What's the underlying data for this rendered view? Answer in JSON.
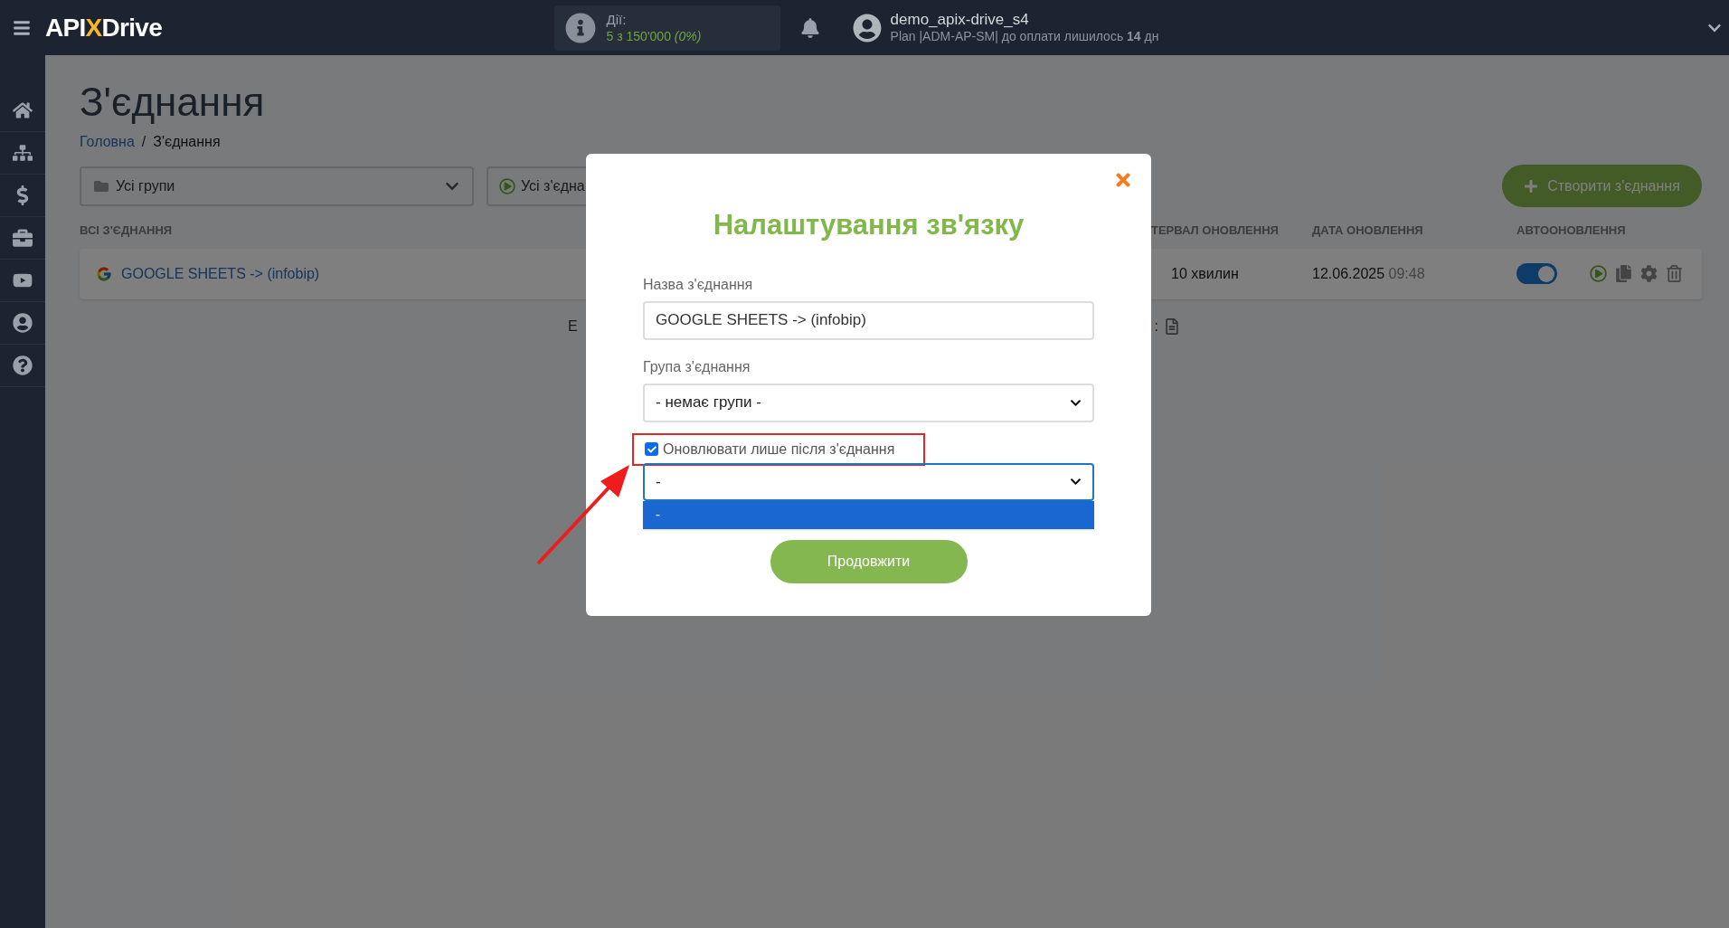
{
  "header": {
    "logo": {
      "left": "API",
      "mark": "X",
      "right": "Drive"
    },
    "actions": {
      "label": "Дії:",
      "value": "5 з 150'000",
      "percent": "(0%)"
    },
    "user": {
      "name": "demo_apix-drive_s4",
      "plan": "Plan |ADM-AP-SM| до оплати лишилось **14** дн"
    }
  },
  "sidebar": {
    "items": [
      {
        "kind": "home"
      },
      {
        "kind": "sitemap"
      },
      {
        "kind": "dollar"
      },
      {
        "kind": "briefcase"
      },
      {
        "kind": "video"
      },
      {
        "kind": "user"
      },
      {
        "kind": "help"
      }
    ]
  },
  "page": {
    "title": "З'єднання",
    "breadcrumb": [
      {
        "label": "Головна"
      },
      {
        "label": "З'єднання"
      }
    ],
    "breadcrumb_separator": "/",
    "filters": {
      "group": "Усі групи",
      "status": "Усі з'єдна"
    },
    "create_button": "Створити з'єднання",
    "table": {
      "columns": [
        "ВСІ З'ЄДНАННЯ",
        "ТЕРВАЛ ОНОВЛЕННЯ",
        "ДАТА ОНОВЛЕННЯ",
        "АВТООНОВЛЕННЯ"
      ],
      "rows": [
        {
          "name": "GOOGLE SHEETS -> (infobip)",
          "interval": "10 хвилин",
          "date": "12.06.2025",
          "time": "09:48",
          "autoupdate": true
        }
      ]
    },
    "footer": {
      "left": "Е",
      "right": ":"
    }
  },
  "modal": {
    "title": "Налаштування зв'язку",
    "name_label": "Назва з'єднання",
    "name_value": "GOOGLE SHEETS -> (infobip)",
    "group_label": "Група з'єднання",
    "group_value": "- немає групи -",
    "checkbox": {
      "label": "Оновлювати лише після з'єднання",
      "checked": true
    },
    "select": {
      "value": "-",
      "options": [
        {
          "label": "-",
          "selected": true
        }
      ]
    },
    "button": "Продовжити"
  }
}
